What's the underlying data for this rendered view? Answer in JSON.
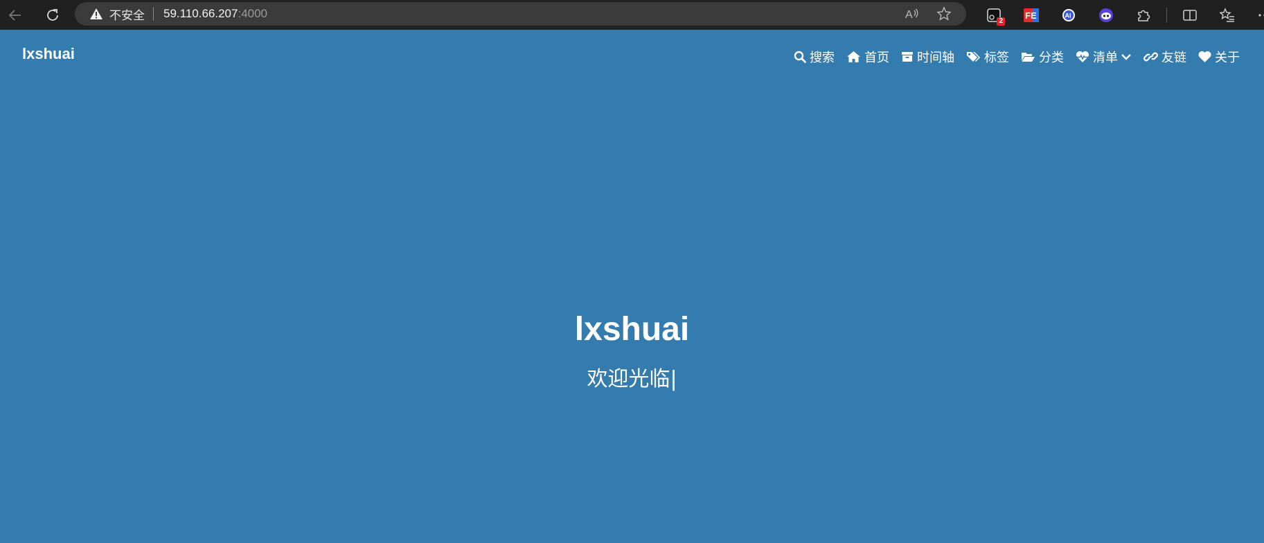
{
  "browser": {
    "security_label": "不安全",
    "url_host": "59.110.66.207",
    "url_port": ":4000",
    "extension_badge": "2",
    "ext_fe_label": "FE",
    "ext_ai_label": "AI"
  },
  "site": {
    "brand": "lxshuai",
    "menu": [
      {
        "label": "搜索",
        "icon": "search-icon"
      },
      {
        "label": "首页",
        "icon": "home-icon"
      },
      {
        "label": "时间轴",
        "icon": "archive-icon"
      },
      {
        "label": "标签",
        "icon": "tags-icon"
      },
      {
        "label": "分类",
        "icon": "folder-open-icon"
      },
      {
        "label": "清单",
        "icon": "heartbeat-icon",
        "dropdown": true
      },
      {
        "label": "友链",
        "icon": "link-icon"
      },
      {
        "label": "关于",
        "icon": "heart-icon"
      }
    ],
    "hero": {
      "title": "lxshuai",
      "subtitle": "欢迎光临",
      "cursor": "|"
    }
  },
  "colors": {
    "background": "#357cae",
    "chrome": "#202020",
    "addressbar": "#3b3b3b"
  }
}
